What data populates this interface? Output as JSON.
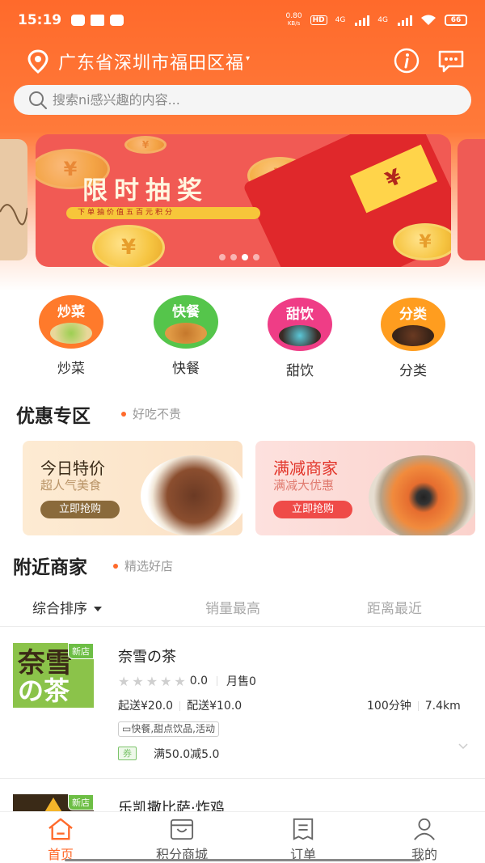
{
  "status_bar": {
    "time": "15:19",
    "net_speed_value": "0.80",
    "net_speed_unit": "KB/s",
    "hd_label": "HD",
    "signal_1_label": "4G",
    "signal_2_label": "4G",
    "battery": "66"
  },
  "header": {
    "location": "广东省深圳市福田区福",
    "search_placeholder": "搜索ni感兴趣的内容..."
  },
  "banner": {
    "title": "限时抽奖",
    "subtitle": "下单抽价值五百元积分",
    "envelope_symbol": "¥",
    "coin_symbol": "¥",
    "active_slide": 3,
    "slide_count": 4
  },
  "categories": [
    {
      "badge": "炒菜",
      "label": "炒菜",
      "color": "#ff7a2b"
    },
    {
      "badge": "快餐",
      "label": "快餐",
      "color": "#55c54b"
    },
    {
      "badge": "甜饮",
      "label": "甜饮",
      "color": "#ef3d86"
    },
    {
      "badge": "分类",
      "label": "分类",
      "color": "#ff9d1f"
    }
  ],
  "discount_section": {
    "title": "优惠专区",
    "subtitle": "好吃不贵",
    "cards": [
      {
        "title": "今日特价",
        "subtitle": "超人气美食",
        "button": "立即抢购",
        "title_color": "#3a2a17",
        "button_color": "#8a6a3b"
      },
      {
        "title": "满减商家",
        "subtitle": "满减大优惠",
        "button": "立即抢购",
        "title_color": "#e2352a",
        "button_color": "#ef4b48"
      }
    ]
  },
  "nearby_section": {
    "title": "附近商家",
    "subtitle": "精选好店",
    "sort_tabs": [
      "综合排序",
      "销量最高",
      "距离最近"
    ]
  },
  "shops": [
    {
      "logo_text_1": "奈雪",
      "logo_text_2": "の茶",
      "new_tag": "新店",
      "name": "奈雪の茶",
      "rating": "0.0",
      "monthly_sales": "月售0",
      "min_order": "起送¥20.0",
      "delivery_fee": "配送¥10.0",
      "delivery_time": "100分钟",
      "distance": "7.4km",
      "tags": "快餐,甜点饮品,活动",
      "coupon_badge": "券",
      "coupon": "满50.0减5.0"
    },
    {
      "new_tag": "新店",
      "name": "乐凯撒比萨·炸鸡"
    }
  ],
  "bottom_nav": [
    {
      "label": "首页",
      "icon": "home-icon"
    },
    {
      "label": "积分商城",
      "icon": "mall-icon"
    },
    {
      "label": "订单",
      "icon": "order-icon"
    },
    {
      "label": "我的",
      "icon": "profile-icon"
    }
  ],
  "colors": {
    "brand_orange": "#ff6a2b",
    "banner_red": "#f15a54"
  }
}
